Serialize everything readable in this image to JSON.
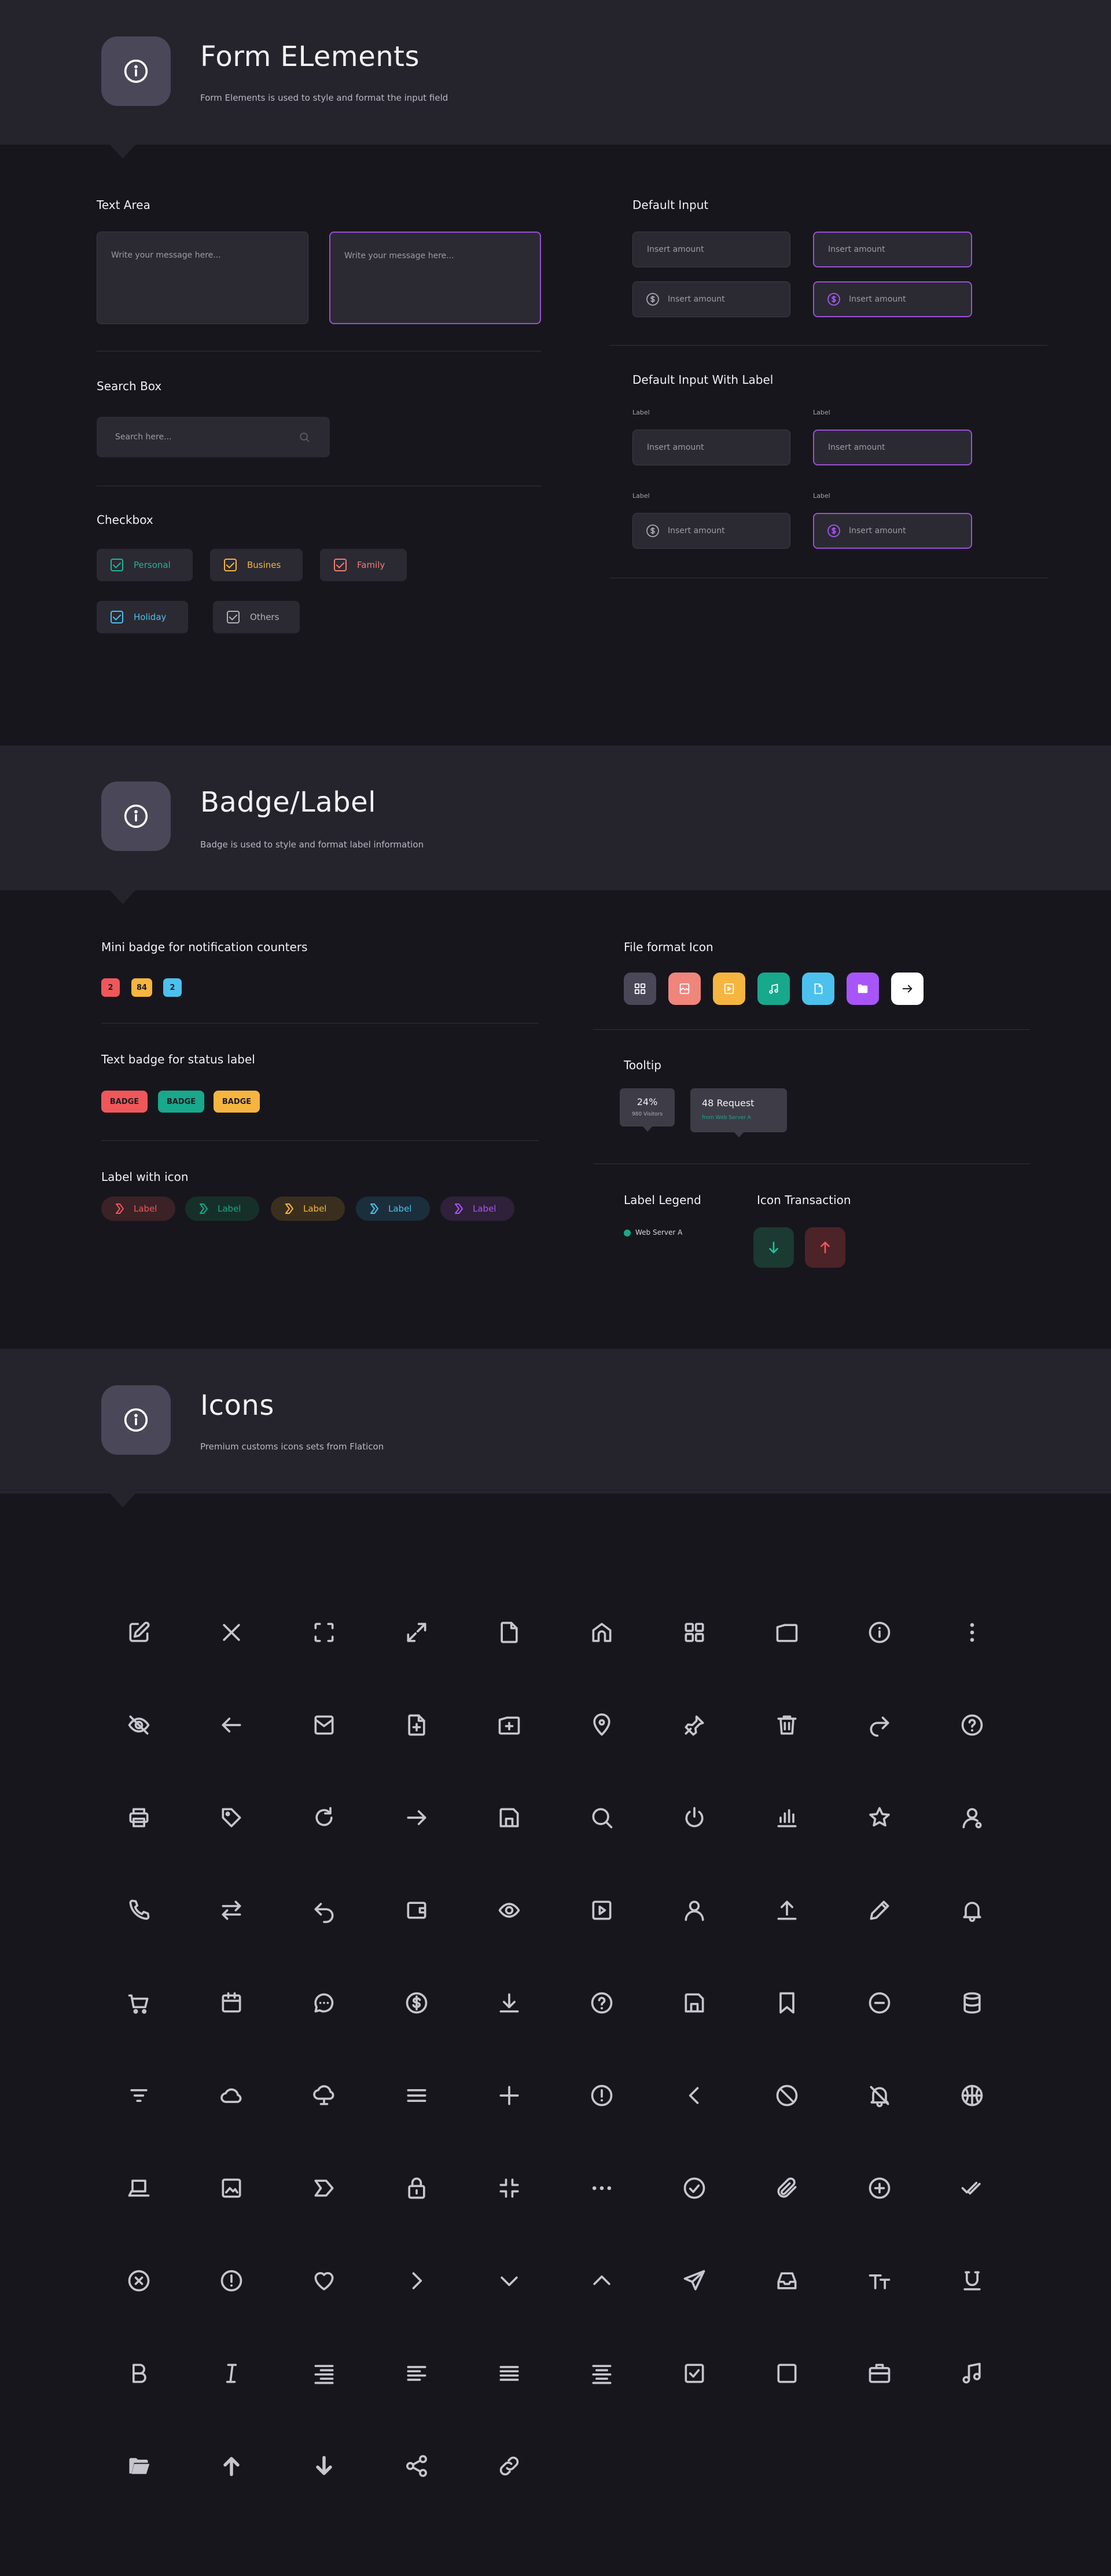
{
  "form_section": {
    "title": "Form ELements",
    "subtitle": "Form Elements is used to style and format the input field",
    "text_area": {
      "title": "Text Area",
      "placeholder": "Write your message here..."
    },
    "search_box": {
      "title": "Search Box",
      "placeholder": "Search here..."
    },
    "checkbox": {
      "title": "Checkbox",
      "items": [
        {
          "label": "Personal",
          "color": "#20b59a"
        },
        {
          "label": "Busines",
          "color": "#f5b53f"
        },
        {
          "label": "Family",
          "color": "#f07d74"
        },
        {
          "label": "Holiday",
          "color": "#4cc1ee"
        },
        {
          "label": "Others",
          "color": "#b3b2bc"
        }
      ]
    },
    "default_input": {
      "title": "Default Input",
      "placeholder": "Insert amount"
    },
    "default_input_label": {
      "title": "Default Input With Label",
      "label": "Label",
      "placeholder": "Insert amount"
    }
  },
  "badge_section": {
    "title": "Badge/Label",
    "subtitle": "Badge is used to style and format label information",
    "mini_badge": {
      "title": "Mini badge for notification counters",
      "items": [
        "2",
        "84",
        "2"
      ]
    },
    "text_badge": {
      "title": "Text badge for status label",
      "items": [
        "BADGE",
        "BADGE",
        "BADGE"
      ]
    },
    "label_icon": {
      "title": "Label with icon",
      "items": [
        "Label",
        "Label",
        "Label",
        "Label",
        "Label"
      ]
    },
    "file_format": {
      "title": "File format Icon"
    },
    "tooltip": {
      "title": "Tooltip",
      "t1_value": "24%",
      "t1_sub": "980 Visitors",
      "t2_value": "48 Request",
      "t2_sub": "from Web Server A"
    },
    "legend": {
      "title": "Label Legend",
      "item": "Web Server A"
    },
    "transaction": {
      "title": "Icon Transaction"
    }
  },
  "icons_section": {
    "title": "Icons",
    "subtitle": "Premium customs icons sets from Flaticon"
  },
  "colors": {
    "accent": "#9b4fd6",
    "red": "#f0575a",
    "orange": "#f5b53f",
    "teal": "#18a88b",
    "blue": "#4cc1ee",
    "purple": "#a855f7"
  }
}
